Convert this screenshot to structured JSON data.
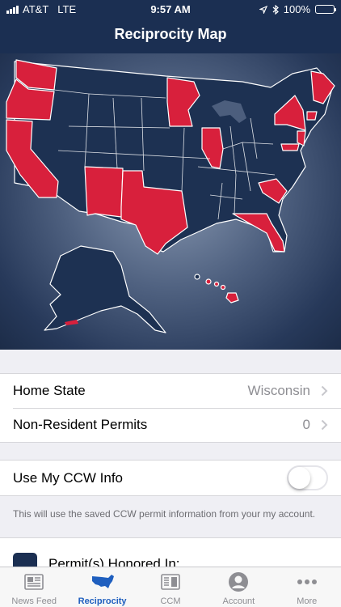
{
  "status_bar": {
    "carrier": "AT&T",
    "network": "LTE",
    "time": "9:57 AM",
    "battery": "100%",
    "icons": [
      "signal-bars-icon",
      "location-arrow-icon",
      "bluetooth-icon",
      "battery-icon"
    ]
  },
  "nav": {
    "title": "Reciprocity Map"
  },
  "colors": {
    "navy": "#1b2f52",
    "honored_red": "#d8203c",
    "state_navy": "#1d3152",
    "accent_blue": "#1f5fbf"
  },
  "map": {
    "icon": "us-map-reciprocity"
  },
  "settings": {
    "home_state_label": "Home State",
    "home_state_value": "Wisconsin",
    "nonresident_label": "Non-Resident Permits",
    "nonresident_value": "0"
  },
  "ccw": {
    "label": "Use My CCW Info",
    "toggle_on": false,
    "note": "This will use the saved CCW permit information from your my account."
  },
  "honored": {
    "label": "Permit(s) Honored In:"
  },
  "tabs": [
    {
      "label": "News Feed",
      "icon": "newspaper-icon",
      "active": false
    },
    {
      "label": "Reciprocity",
      "icon": "us-map-icon",
      "active": true
    },
    {
      "label": "CCM",
      "icon": "magazine-icon",
      "active": false
    },
    {
      "label": "Account",
      "icon": "user-avatar-icon",
      "active": false
    },
    {
      "label": "More",
      "icon": "more-dots-icon",
      "active": false
    }
  ]
}
